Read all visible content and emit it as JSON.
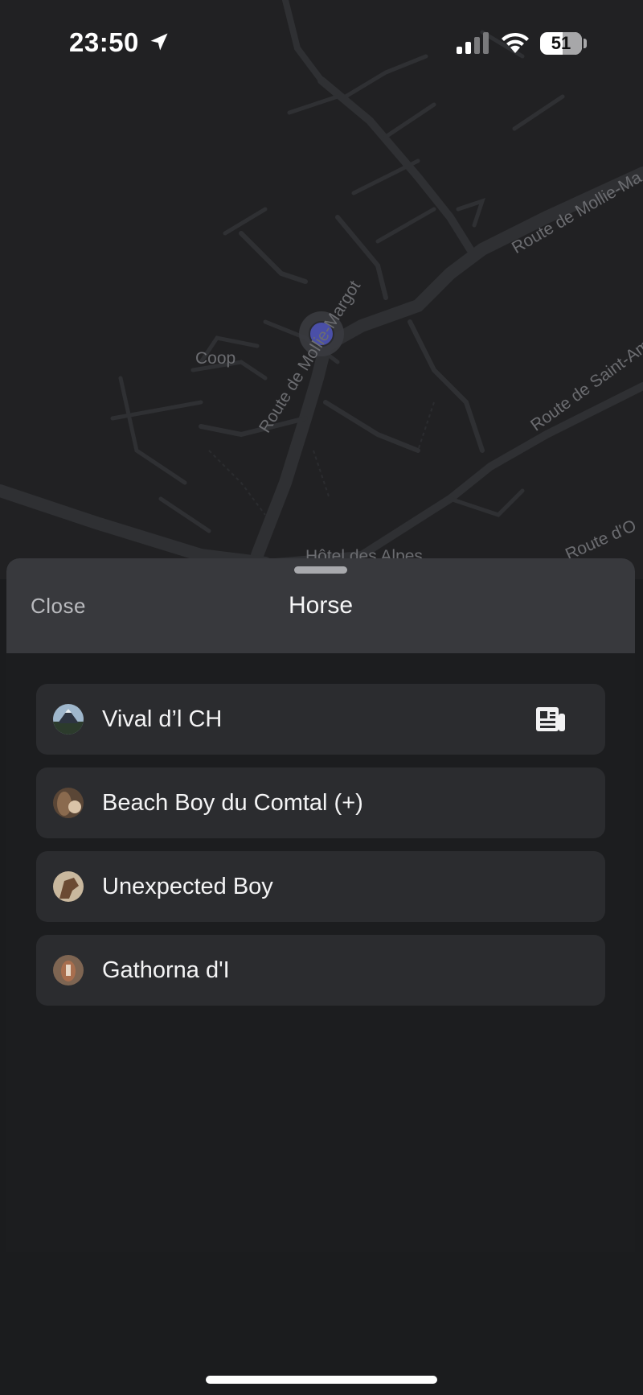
{
  "status_bar": {
    "time": "23:50",
    "battery_level": "51",
    "icons": [
      "location-arrow-icon",
      "cellular-signal-icon",
      "wifi-icon",
      "battery-icon"
    ]
  },
  "map": {
    "labels": {
      "coop": "Coop",
      "route_mollie_margot": "Route de Mollie-Margot",
      "route_mollie_ma": "Route de Mollie-Ma",
      "route_saint_amo": "Route de Saint-Amo",
      "route_o": "Route d'O",
      "hotel": "Hôtel des Alpes"
    },
    "user_dot_color": "#4a4fa8"
  },
  "sheet": {
    "close_label": "Close",
    "title": "Horse",
    "horses": [
      {
        "name": "Vival d’l CH",
        "avatar": "mountain-photo",
        "has_report_icon": true
      },
      {
        "name": "Beach Boy du Comtal (+)",
        "avatar": "horse-photo",
        "has_report_icon": false
      },
      {
        "name": "Unexpected Boy",
        "avatar": "horse-photo",
        "has_report_icon": false
      },
      {
        "name": "Gathorna d'I",
        "avatar": "horse-photo",
        "has_report_icon": false
      }
    ]
  },
  "colors": {
    "background": "#1b1c1e",
    "sheet_header": "#38393d",
    "row_background": "#2b2c2f",
    "map_background": "#212123"
  }
}
